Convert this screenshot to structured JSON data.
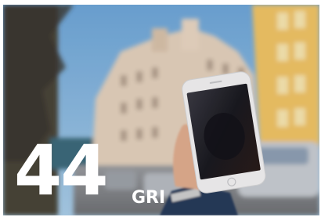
{
  "overlay": {
    "number": "44",
    "unit": "GRI"
  },
  "palette": {
    "sky": "#7fb2de",
    "building_left": "#e8d5c2",
    "building_right": "#f2c968",
    "street": "#8a8d92",
    "phone_frame": "#f0eff0",
    "text": "#ffffff"
  }
}
